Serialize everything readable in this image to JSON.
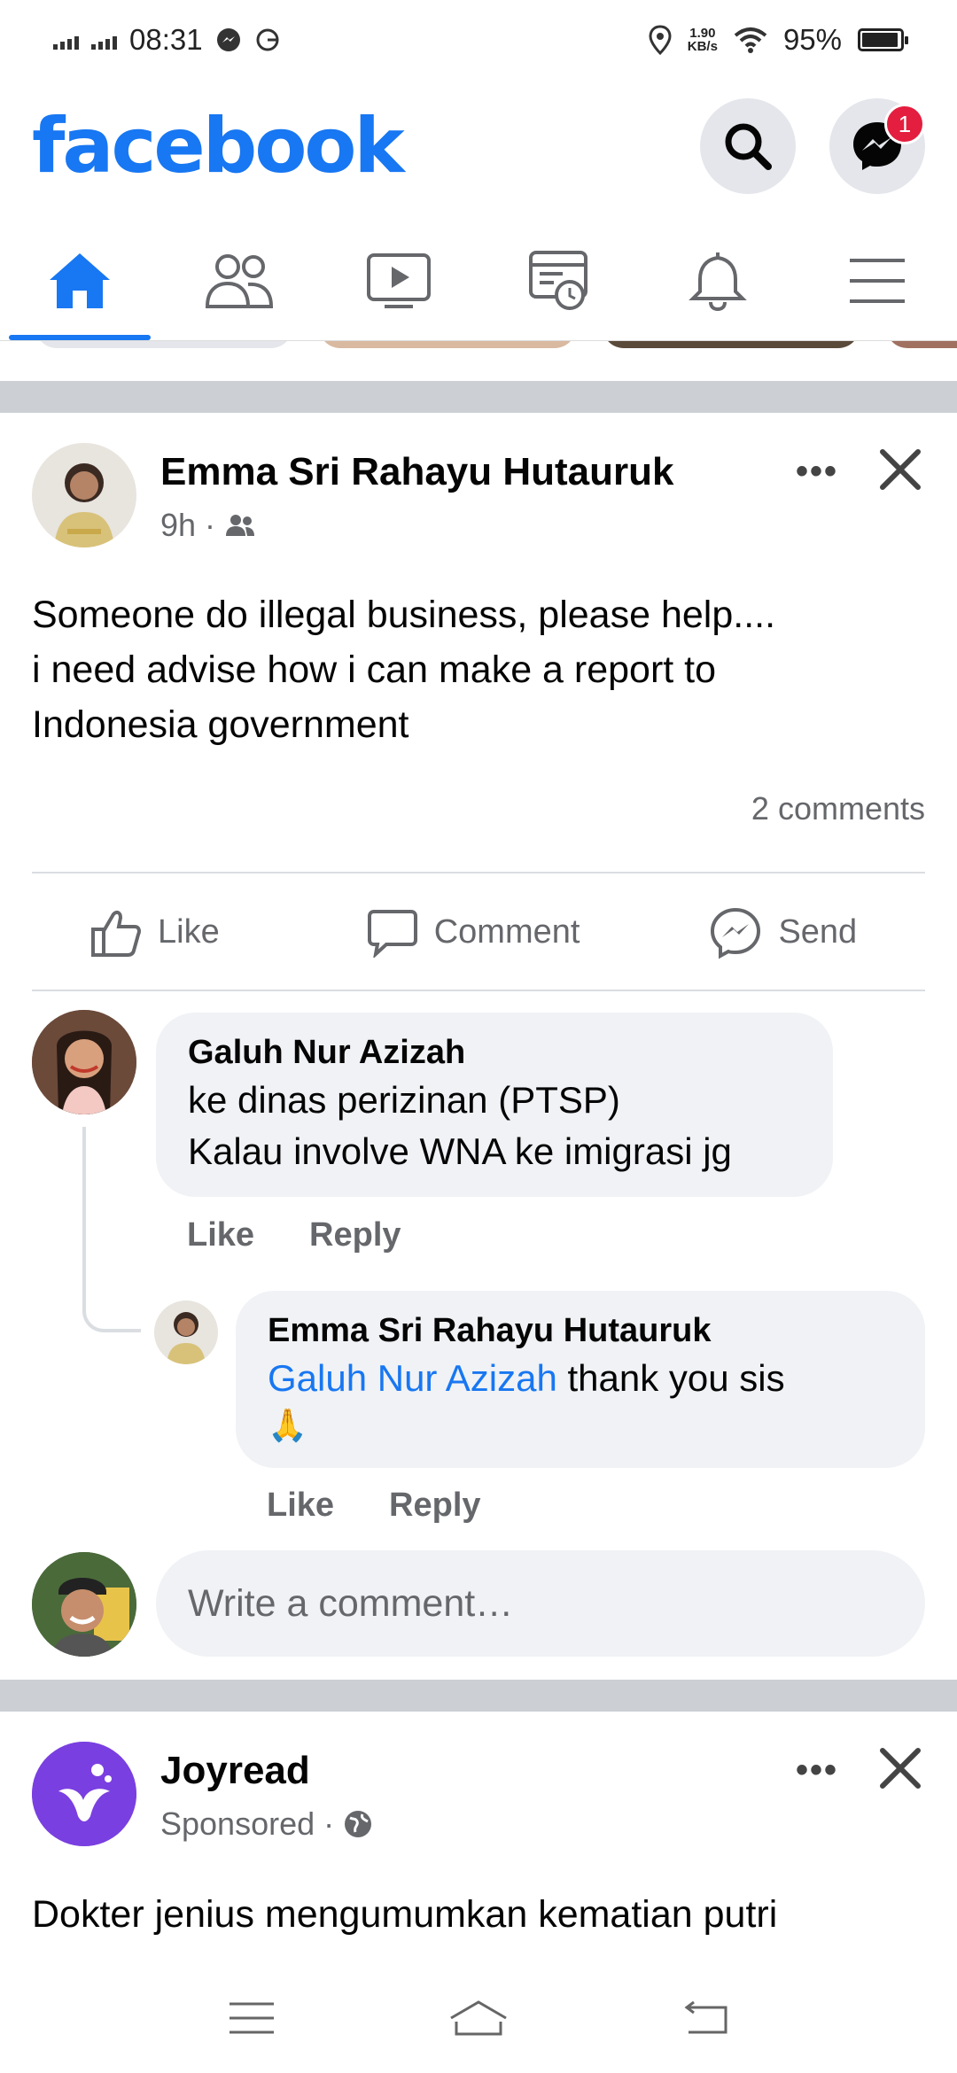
{
  "status_bar": {
    "time": "08:31",
    "net_speed_value": "1.90",
    "net_speed_unit": "KB/s",
    "battery": "95%",
    "battery_level": 0.95
  },
  "header": {
    "logo": "facebook",
    "messenger_badge": "1",
    "brand_color": "#1877f2"
  },
  "tabs": [
    {
      "name": "home-icon",
      "active": true
    },
    {
      "name": "friends-icon",
      "active": false
    },
    {
      "name": "watch-icon",
      "active": false
    },
    {
      "name": "memories-icon",
      "active": false
    },
    {
      "name": "bell-icon",
      "active": false
    },
    {
      "name": "menu-icon",
      "active": false
    }
  ],
  "post": {
    "author": "Emma Sri Rahayu Hutauruk",
    "time": "9h",
    "audience_icon": "friends-icon",
    "text_lines": [
      "Someone do illegal business, please help....",
      "i need advise how i can make a report to",
      "Indonesia government"
    ],
    "comments_count": "2 comments",
    "actions": {
      "like": "Like",
      "comment": "Comment",
      "send": "Send"
    }
  },
  "comments": [
    {
      "author": "Galuh Nur Azizah",
      "lines": [
        "ke dinas perizinan (PTSP)",
        "Kalau involve WNA ke imigrasi jg"
      ],
      "like": "Like",
      "reply": "Reply"
    },
    {
      "author": "Emma Sri Rahayu Hutauruk",
      "mention": "Galuh Nur Azizah",
      "text": " thank you sis",
      "emoji": "🙏",
      "like": "Like",
      "reply": "Reply"
    }
  ],
  "write_comment_placeholder": "Write a comment…",
  "sponsored": {
    "author": "Joyread",
    "label": "Sponsored",
    "text": "Dokter jenius mengumumkan kematian putri"
  }
}
